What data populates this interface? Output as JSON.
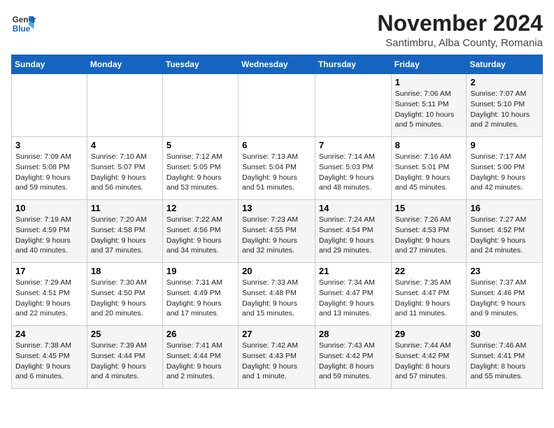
{
  "logo": {
    "line1": "General",
    "line2": "Blue"
  },
  "title": "November 2024",
  "location": "Santimbru, Alba County, Romania",
  "days_header": [
    "Sunday",
    "Monday",
    "Tuesday",
    "Wednesday",
    "Thursday",
    "Friday",
    "Saturday"
  ],
  "weeks": [
    [
      {
        "day": "",
        "info": ""
      },
      {
        "day": "",
        "info": ""
      },
      {
        "day": "",
        "info": ""
      },
      {
        "day": "",
        "info": ""
      },
      {
        "day": "",
        "info": ""
      },
      {
        "day": "1",
        "info": "Sunrise: 7:06 AM\nSunset: 5:11 PM\nDaylight: 10 hours\nand 5 minutes."
      },
      {
        "day": "2",
        "info": "Sunrise: 7:07 AM\nSunset: 5:10 PM\nDaylight: 10 hours\nand 2 minutes."
      }
    ],
    [
      {
        "day": "3",
        "info": "Sunrise: 7:09 AM\nSunset: 5:08 PM\nDaylight: 9 hours\nand 59 minutes."
      },
      {
        "day": "4",
        "info": "Sunrise: 7:10 AM\nSunset: 5:07 PM\nDaylight: 9 hours\nand 56 minutes."
      },
      {
        "day": "5",
        "info": "Sunrise: 7:12 AM\nSunset: 5:05 PM\nDaylight: 9 hours\nand 53 minutes."
      },
      {
        "day": "6",
        "info": "Sunrise: 7:13 AM\nSunset: 5:04 PM\nDaylight: 9 hours\nand 51 minutes."
      },
      {
        "day": "7",
        "info": "Sunrise: 7:14 AM\nSunset: 5:03 PM\nDaylight: 9 hours\nand 48 minutes."
      },
      {
        "day": "8",
        "info": "Sunrise: 7:16 AM\nSunset: 5:01 PM\nDaylight: 9 hours\nand 45 minutes."
      },
      {
        "day": "9",
        "info": "Sunrise: 7:17 AM\nSunset: 5:00 PM\nDaylight: 9 hours\nand 42 minutes."
      }
    ],
    [
      {
        "day": "10",
        "info": "Sunrise: 7:19 AM\nSunset: 4:59 PM\nDaylight: 9 hours\nand 40 minutes."
      },
      {
        "day": "11",
        "info": "Sunrise: 7:20 AM\nSunset: 4:58 PM\nDaylight: 9 hours\nand 37 minutes."
      },
      {
        "day": "12",
        "info": "Sunrise: 7:22 AM\nSunset: 4:56 PM\nDaylight: 9 hours\nand 34 minutes."
      },
      {
        "day": "13",
        "info": "Sunrise: 7:23 AM\nSunset: 4:55 PM\nDaylight: 9 hours\nand 32 minutes."
      },
      {
        "day": "14",
        "info": "Sunrise: 7:24 AM\nSunset: 4:54 PM\nDaylight: 9 hours\nand 29 minutes."
      },
      {
        "day": "15",
        "info": "Sunrise: 7:26 AM\nSunset: 4:53 PM\nDaylight: 9 hours\nand 27 minutes."
      },
      {
        "day": "16",
        "info": "Sunrise: 7:27 AM\nSunset: 4:52 PM\nDaylight: 9 hours\nand 24 minutes."
      }
    ],
    [
      {
        "day": "17",
        "info": "Sunrise: 7:29 AM\nSunset: 4:51 PM\nDaylight: 9 hours\nand 22 minutes."
      },
      {
        "day": "18",
        "info": "Sunrise: 7:30 AM\nSunset: 4:50 PM\nDaylight: 9 hours\nand 20 minutes."
      },
      {
        "day": "19",
        "info": "Sunrise: 7:31 AM\nSunset: 4:49 PM\nDaylight: 9 hours\nand 17 minutes."
      },
      {
        "day": "20",
        "info": "Sunrise: 7:33 AM\nSunset: 4:48 PM\nDaylight: 9 hours\nand 15 minutes."
      },
      {
        "day": "21",
        "info": "Sunrise: 7:34 AM\nSunset: 4:47 PM\nDaylight: 9 hours\nand 13 minutes."
      },
      {
        "day": "22",
        "info": "Sunrise: 7:35 AM\nSunset: 4:47 PM\nDaylight: 9 hours\nand 11 minutes."
      },
      {
        "day": "23",
        "info": "Sunrise: 7:37 AM\nSunset: 4:46 PM\nDaylight: 9 hours\nand 9 minutes."
      }
    ],
    [
      {
        "day": "24",
        "info": "Sunrise: 7:38 AM\nSunset: 4:45 PM\nDaylight: 9 hours\nand 6 minutes."
      },
      {
        "day": "25",
        "info": "Sunrise: 7:39 AM\nSunset: 4:44 PM\nDaylight: 9 hours\nand 4 minutes."
      },
      {
        "day": "26",
        "info": "Sunrise: 7:41 AM\nSunset: 4:44 PM\nDaylight: 9 hours\nand 2 minutes."
      },
      {
        "day": "27",
        "info": "Sunrise: 7:42 AM\nSunset: 4:43 PM\nDaylight: 9 hours\nand 1 minute."
      },
      {
        "day": "28",
        "info": "Sunrise: 7:43 AM\nSunset: 4:42 PM\nDaylight: 8 hours\nand 59 minutes."
      },
      {
        "day": "29",
        "info": "Sunrise: 7:44 AM\nSunset: 4:42 PM\nDaylight: 8 hours\nand 57 minutes."
      },
      {
        "day": "30",
        "info": "Sunrise: 7:46 AM\nSunset: 4:41 PM\nDaylight: 8 hours\nand 55 minutes."
      }
    ]
  ]
}
